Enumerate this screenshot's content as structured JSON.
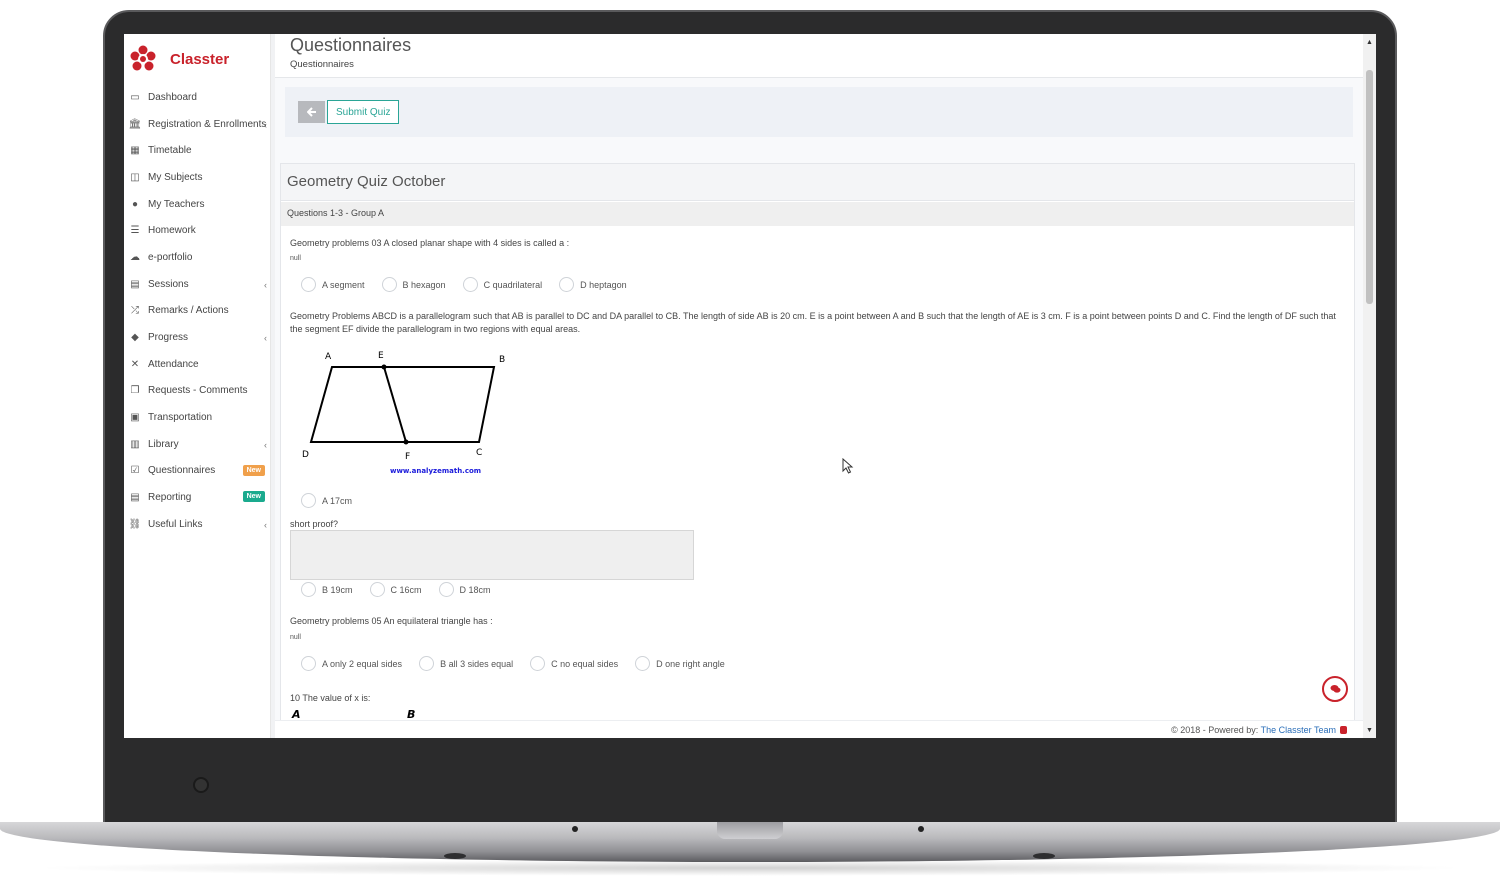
{
  "brand": {
    "name": "Classter"
  },
  "sidebar": {
    "items": [
      {
        "label": "Dashboard",
        "icon": "laptop-icon",
        "chevron": false
      },
      {
        "label": "Registration & Enrollments",
        "icon": "bank-icon",
        "chevron": true
      },
      {
        "label": "Timetable",
        "icon": "calendar-icon",
        "chevron": false
      },
      {
        "label": "My Subjects",
        "icon": "columns-icon",
        "chevron": false
      },
      {
        "label": "My Teachers",
        "icon": "user-icon",
        "chevron": false
      },
      {
        "label": "Homework",
        "icon": "list-icon",
        "chevron": false
      },
      {
        "label": "e-portfolio",
        "icon": "cloud-icon",
        "chevron": false
      },
      {
        "label": "Sessions",
        "icon": "table-icon",
        "chevron": true
      },
      {
        "label": "Remarks / Actions",
        "icon": "shuffle-icon",
        "chevron": false
      },
      {
        "label": "Progress",
        "icon": "graduation-cap-icon",
        "chevron": true
      },
      {
        "label": "Attendance",
        "icon": "user-times-icon",
        "chevron": false
      },
      {
        "label": "Requests - Comments",
        "icon": "documents-icon",
        "chevron": false
      },
      {
        "label": "Transportation",
        "icon": "bus-icon",
        "chevron": false
      },
      {
        "label": "Library",
        "icon": "book-icon",
        "chevron": true
      },
      {
        "label": "Questionnaires",
        "icon": "checkbox-icon",
        "chevron": false,
        "badge": "New",
        "badge_color": "#f0a04b"
      },
      {
        "label": "Reporting",
        "icon": "print-icon",
        "chevron": false,
        "badge": "New",
        "badge_color": "#1aaa8e"
      },
      {
        "label": "Useful Links",
        "icon": "link-icon",
        "chevron": true
      }
    ]
  },
  "header": {
    "title": "Questionnaires",
    "breadcrumb": "Questionnaires"
  },
  "toolbar": {
    "back_icon": "arrow-left-icon",
    "submit_label": "Submit Quiz"
  },
  "quiz": {
    "title": "Geometry Quiz October",
    "group": "Questions 1-3 - Group A",
    "q1": {
      "text": "Geometry problems 03 A closed planar shape with 4 sides is called a :",
      "note": "null",
      "options": [
        "A segment",
        "B hexagon",
        "C quadrilateral",
        "D heptagon"
      ]
    },
    "q2": {
      "text": "Geometry Problems ABCD is a parallelogram such that AB is parallel to DC and DA parallel to CB. The length of side AB is 20 cm. E is a point between A and B such that the length of AE is 3 cm. F is a point between points D and C. Find the length of DF such that the segment EF divide the parallelogram in two regions with equal areas.",
      "figure": {
        "labels": [
          "A",
          "E",
          "B",
          "D",
          "F",
          "C"
        ],
        "credit": "www.analyzemath.com"
      },
      "option_first": "A 17cm",
      "proof_label": "short proof?",
      "options_rest": [
        "B 19cm",
        "C 16cm",
        "D 18cm"
      ]
    },
    "q3": {
      "text": "Geometry problems 05 An equilateral triangle has :",
      "note": "null",
      "options": [
        "A only 2 equal sides",
        "B all 3 sides equal",
        "C no equal sides",
        "D one right angle"
      ]
    },
    "q4": {
      "text": "10 The value of x is:",
      "figure_labels": [
        "A",
        "B"
      ]
    }
  },
  "footer": {
    "text": "© 2018 - Powered by: ",
    "link": "The Classter Team"
  },
  "colors": {
    "brand": "#c9222b",
    "accent": "#2aa596",
    "badge_orange": "#f0a04b",
    "badge_green": "#1aaa8e"
  }
}
